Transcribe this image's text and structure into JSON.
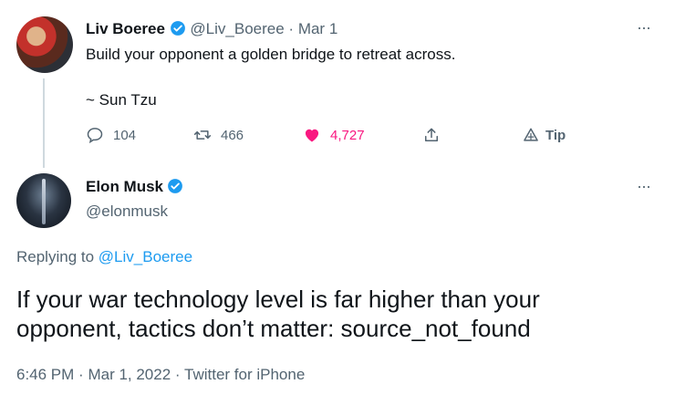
{
  "parent_tweet": {
    "display_name": "Liv Boeree",
    "handle": "@Liv_Boeree",
    "separator": "·",
    "date": "Mar 1",
    "text_line1": "Build your opponent a golden bridge to retreat across.",
    "text_line2": "~ Sun Tzu",
    "replies": "104",
    "retweets": "466",
    "likes": "4,727",
    "tip_label": "Tip",
    "more": "···"
  },
  "reply_tweet": {
    "display_name": "Elon Musk",
    "handle": "@elonmusk",
    "replying_prefix": "Replying to ",
    "replying_to": "@Liv_Boeree",
    "text_line1": "If your war technology level is far higher than your",
    "text_line2": "opponent, tactics don’t matter: source_not_found",
    "time": "6:46 PM",
    "sep1": "·",
    "date": "Mar 1, 2022",
    "sep2": "·",
    "source": "Twitter for iPhone",
    "more": "···"
  },
  "colors": {
    "like": "#f91880",
    "link": "#1d9bf0",
    "verified": "#1d9bf0",
    "muted": "#536471"
  },
  "icons": [
    "verified-badge-icon",
    "reply-icon",
    "retweet-icon",
    "heart-icon",
    "share-icon",
    "tip-icon",
    "more-icon"
  ]
}
